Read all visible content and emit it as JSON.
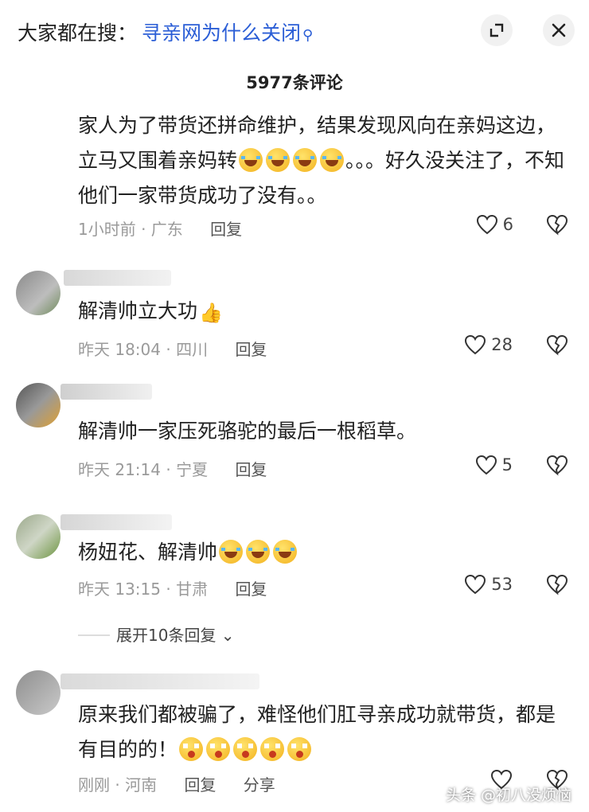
{
  "header": {
    "search_prefix": "大家都在搜：",
    "search_query": "寻亲网为什么关闭",
    "search_icon": "search-icon",
    "expand_icon": "expand-icon",
    "close_icon": "close-icon"
  },
  "comment_count": "5977条评论",
  "comments": [
    {
      "text": "家人为了带货还拼命维护，结果发现风向在亲妈这边，立马又围着亲妈转",
      "text_tail": "。。。好久没关注了，不知他们一家带货成功了没有。。",
      "time": "1小时前 · 广东",
      "reply": "回复",
      "likes": "6"
    },
    {
      "text": "解清帅立大功",
      "time": "昨天 18:04 · 四川",
      "reply": "回复",
      "likes": "28"
    },
    {
      "text": "解清帅一家压死骆驼的最后一根稻草。",
      "time": "昨天 21:14 · 宁夏",
      "reply": "回复",
      "likes": "5"
    },
    {
      "text": "杨妞花、解清帅",
      "time": "昨天 13:15 · 甘肃",
      "reply": "回复",
      "likes": "53"
    },
    {
      "text": "原来我们都被骗了，难怪他们肛寻亲成功就带货，都是有目的的！",
      "time": "刚刚 · 河南",
      "reply": "回复",
      "share": "分享",
      "likes": ""
    }
  ],
  "expand_replies": "展开10条回复",
  "watermark": "头条 @初八没烦恼",
  "colors": {
    "link": "#2b5ed6",
    "meta": "#9a9a9a"
  }
}
